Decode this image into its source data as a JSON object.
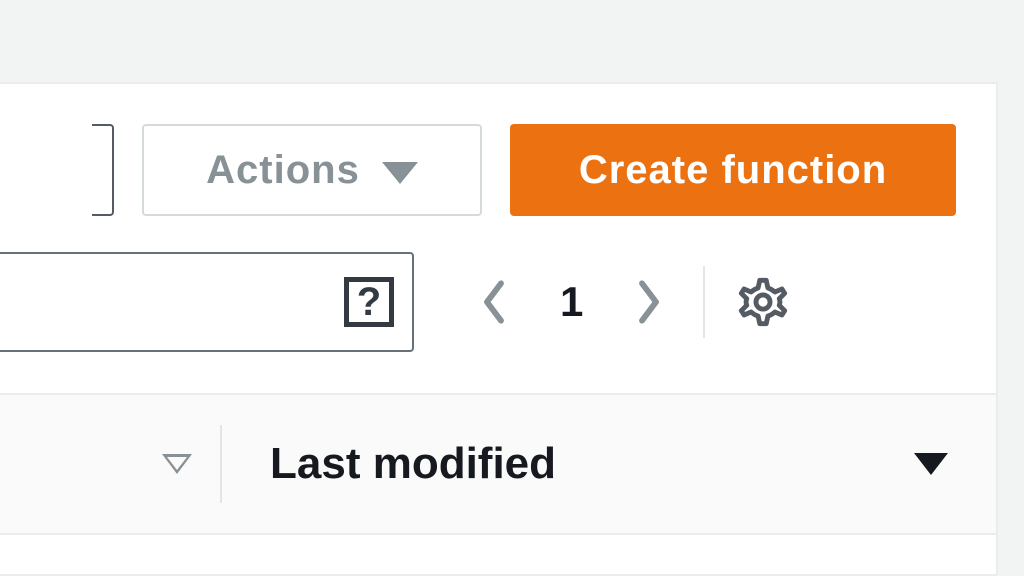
{
  "toolbar": {
    "actions_label": "Actions",
    "create_label": "Create function"
  },
  "pager": {
    "current_page": "1"
  },
  "columns": {
    "last_modified_label": "Last modified"
  }
}
